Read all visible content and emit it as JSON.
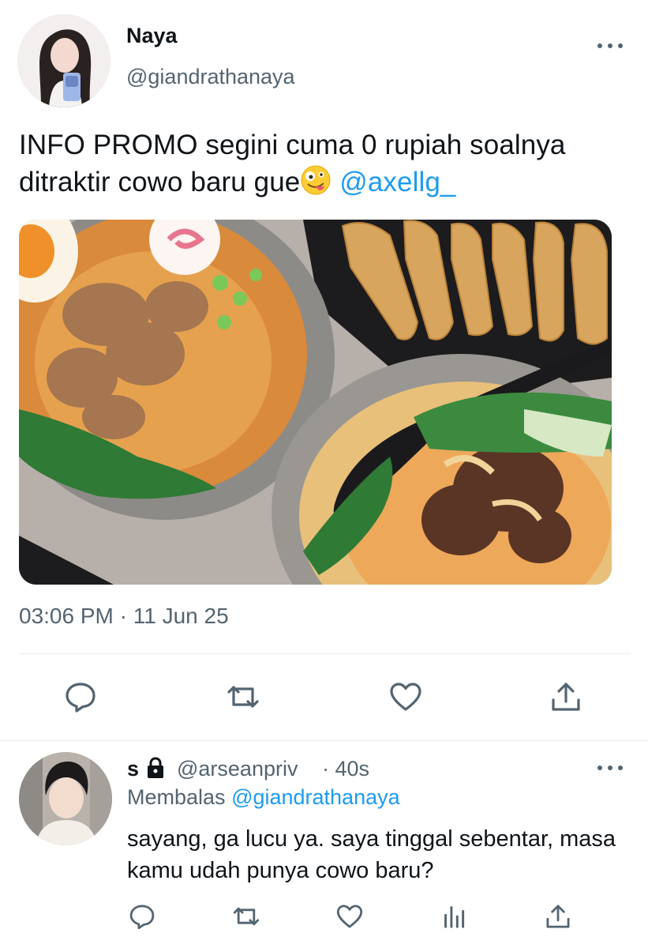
{
  "tweet": {
    "author_name": "Naya",
    "author_handle": "@giandrathanaya",
    "text_part1": "INFO PROMO segini cuma 0 rupiah soalnya ditraktir cowo baru gue",
    "emoji": "zany-face-emoji",
    "mention": "@axellg_",
    "timestamp": "03:06 PM · 11 Jun 25",
    "actions": [
      "reply-icon",
      "retweet-icon",
      "like-icon",
      "share-icon"
    ]
  },
  "reply": {
    "author_name": "s",
    "lock": "lock-icon",
    "author_handle": "@arseanpriv",
    "time": "· 40s",
    "replying_label": "Membalas",
    "replying_to": "@giandrathanaya",
    "text": "sayang, ga lucu ya. saya tinggal sebentar, masa kamu udah punya cowo baru?",
    "actions": [
      "reply-icon",
      "retweet-icon",
      "like-icon",
      "analytics-icon",
      "share-icon"
    ]
  },
  "colors": {
    "text": "#0f1419",
    "secondary": "#536471",
    "accent": "#1d9bf0",
    "divider": "#e6ecf0"
  }
}
